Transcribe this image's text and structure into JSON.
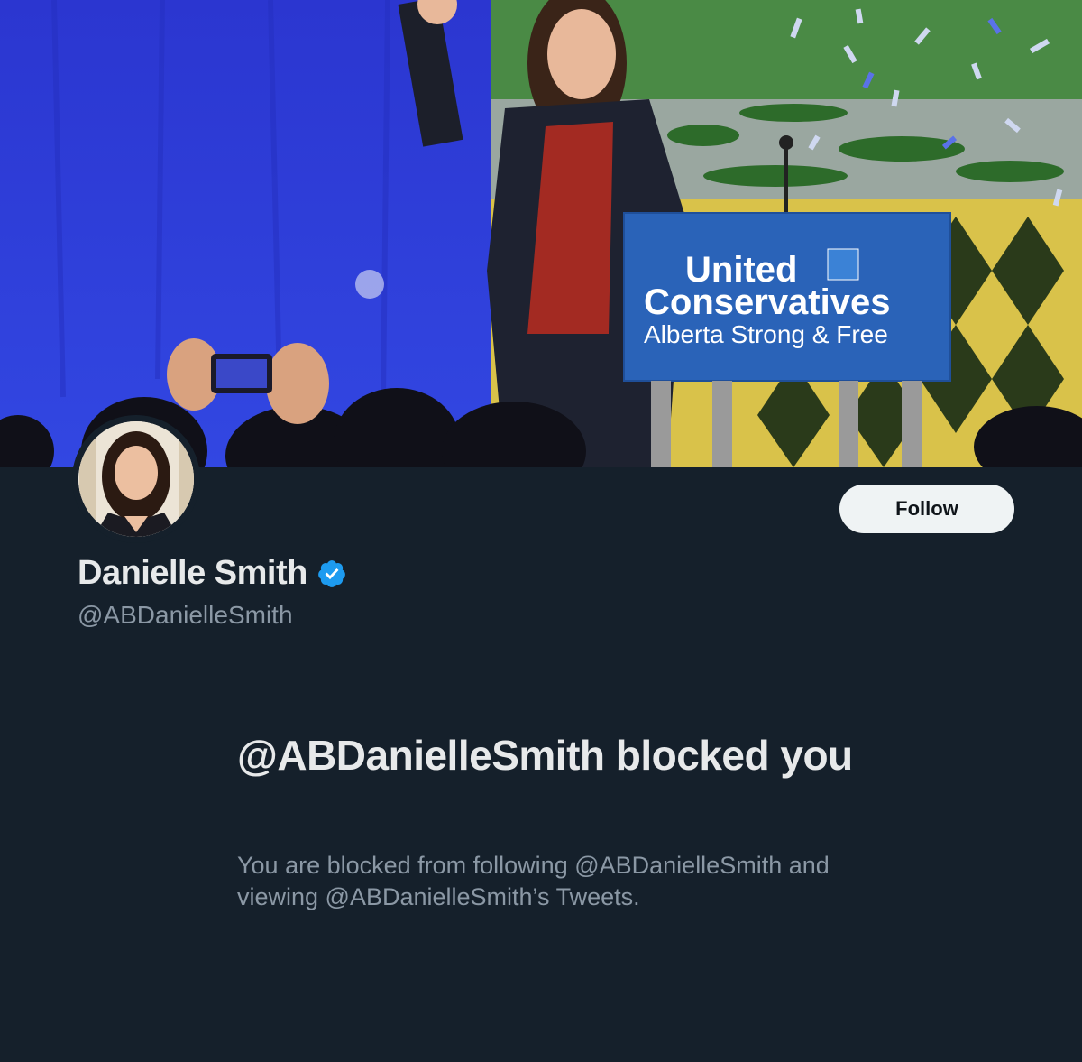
{
  "banner": {
    "image_description": "Profile header photo",
    "podium_line1": "United",
    "podium_line2": "Conservatives",
    "podium_line3": "Alberta Strong & Free"
  },
  "profile": {
    "display_name": "Danielle Smith",
    "handle": "@ABDanielleSmith",
    "verified": true,
    "follow_label": "Follow"
  },
  "blocked": {
    "title": "@ABDanielleSmith blocked you",
    "message": "You are blocked from following @ABDanielleSmith and viewing @ABDanielleSmith’s Tweets."
  },
  "colors": {
    "background": "#15202b",
    "primary_text": "#e7e9ea",
    "secondary_text": "#8b98a5",
    "verified": "#1d9bf0",
    "follow_button_bg": "#eff3f4"
  },
  "icons": {
    "verified": "verified-badge-icon"
  }
}
